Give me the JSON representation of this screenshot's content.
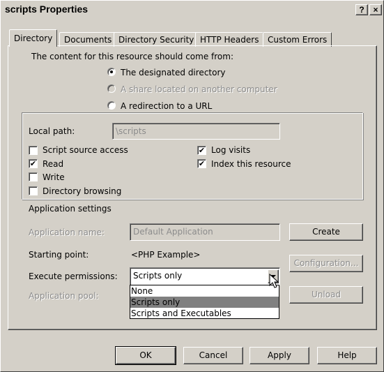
{
  "window": {
    "title": "scripts Properties",
    "help_button": "?",
    "close_button": "×"
  },
  "tabs": [
    {
      "label": "Directory",
      "active": true
    },
    {
      "label": "Documents",
      "active": false
    },
    {
      "label": "Directory Security",
      "active": false
    },
    {
      "label": "HTTP Headers",
      "active": false
    },
    {
      "label": "Custom Errors",
      "active": false
    }
  ],
  "content_source": {
    "heading": "The content for this resource should come from:",
    "options": [
      {
        "label": "The designated directory",
        "selected": true,
        "enabled": true
      },
      {
        "label": "A share located on another computer",
        "selected": false,
        "enabled": false
      },
      {
        "label": "A redirection to a URL",
        "selected": false,
        "enabled": true
      }
    ]
  },
  "local_path": {
    "label": "Local path:",
    "value": "\\scripts"
  },
  "checkboxes_left": [
    {
      "label": "Script source access",
      "checked": false
    },
    {
      "label": "Read",
      "checked": true
    },
    {
      "label": "Write",
      "checked": false
    },
    {
      "label": "Directory browsing",
      "checked": false
    }
  ],
  "checkboxes_right": [
    {
      "label": "Log visits",
      "checked": true
    },
    {
      "label": "Index this resource",
      "checked": true
    }
  ],
  "app_settings": {
    "heading": "Application settings",
    "app_name_label": "Application name:",
    "app_name_value": "Default Application",
    "create_button": "Create",
    "starting_point_label": "Starting point:",
    "starting_point_value": "<PHP Example>",
    "configuration_button": "Configuration...",
    "execute_label": "Execute permissions:",
    "execute_value": "Scripts only",
    "execute_options": [
      "None",
      "Scripts only",
      "Scripts and Executables"
    ],
    "execute_selected_index": 1,
    "app_pool_label": "Application pool:",
    "unload_button": "Unload"
  },
  "footer": {
    "ok": "OK",
    "cancel": "Cancel",
    "apply": "Apply",
    "help": "Help"
  },
  "colors": {
    "face": "#d4d0c8",
    "highlight": "#808080",
    "disabled_text": "#8c8c8c"
  }
}
